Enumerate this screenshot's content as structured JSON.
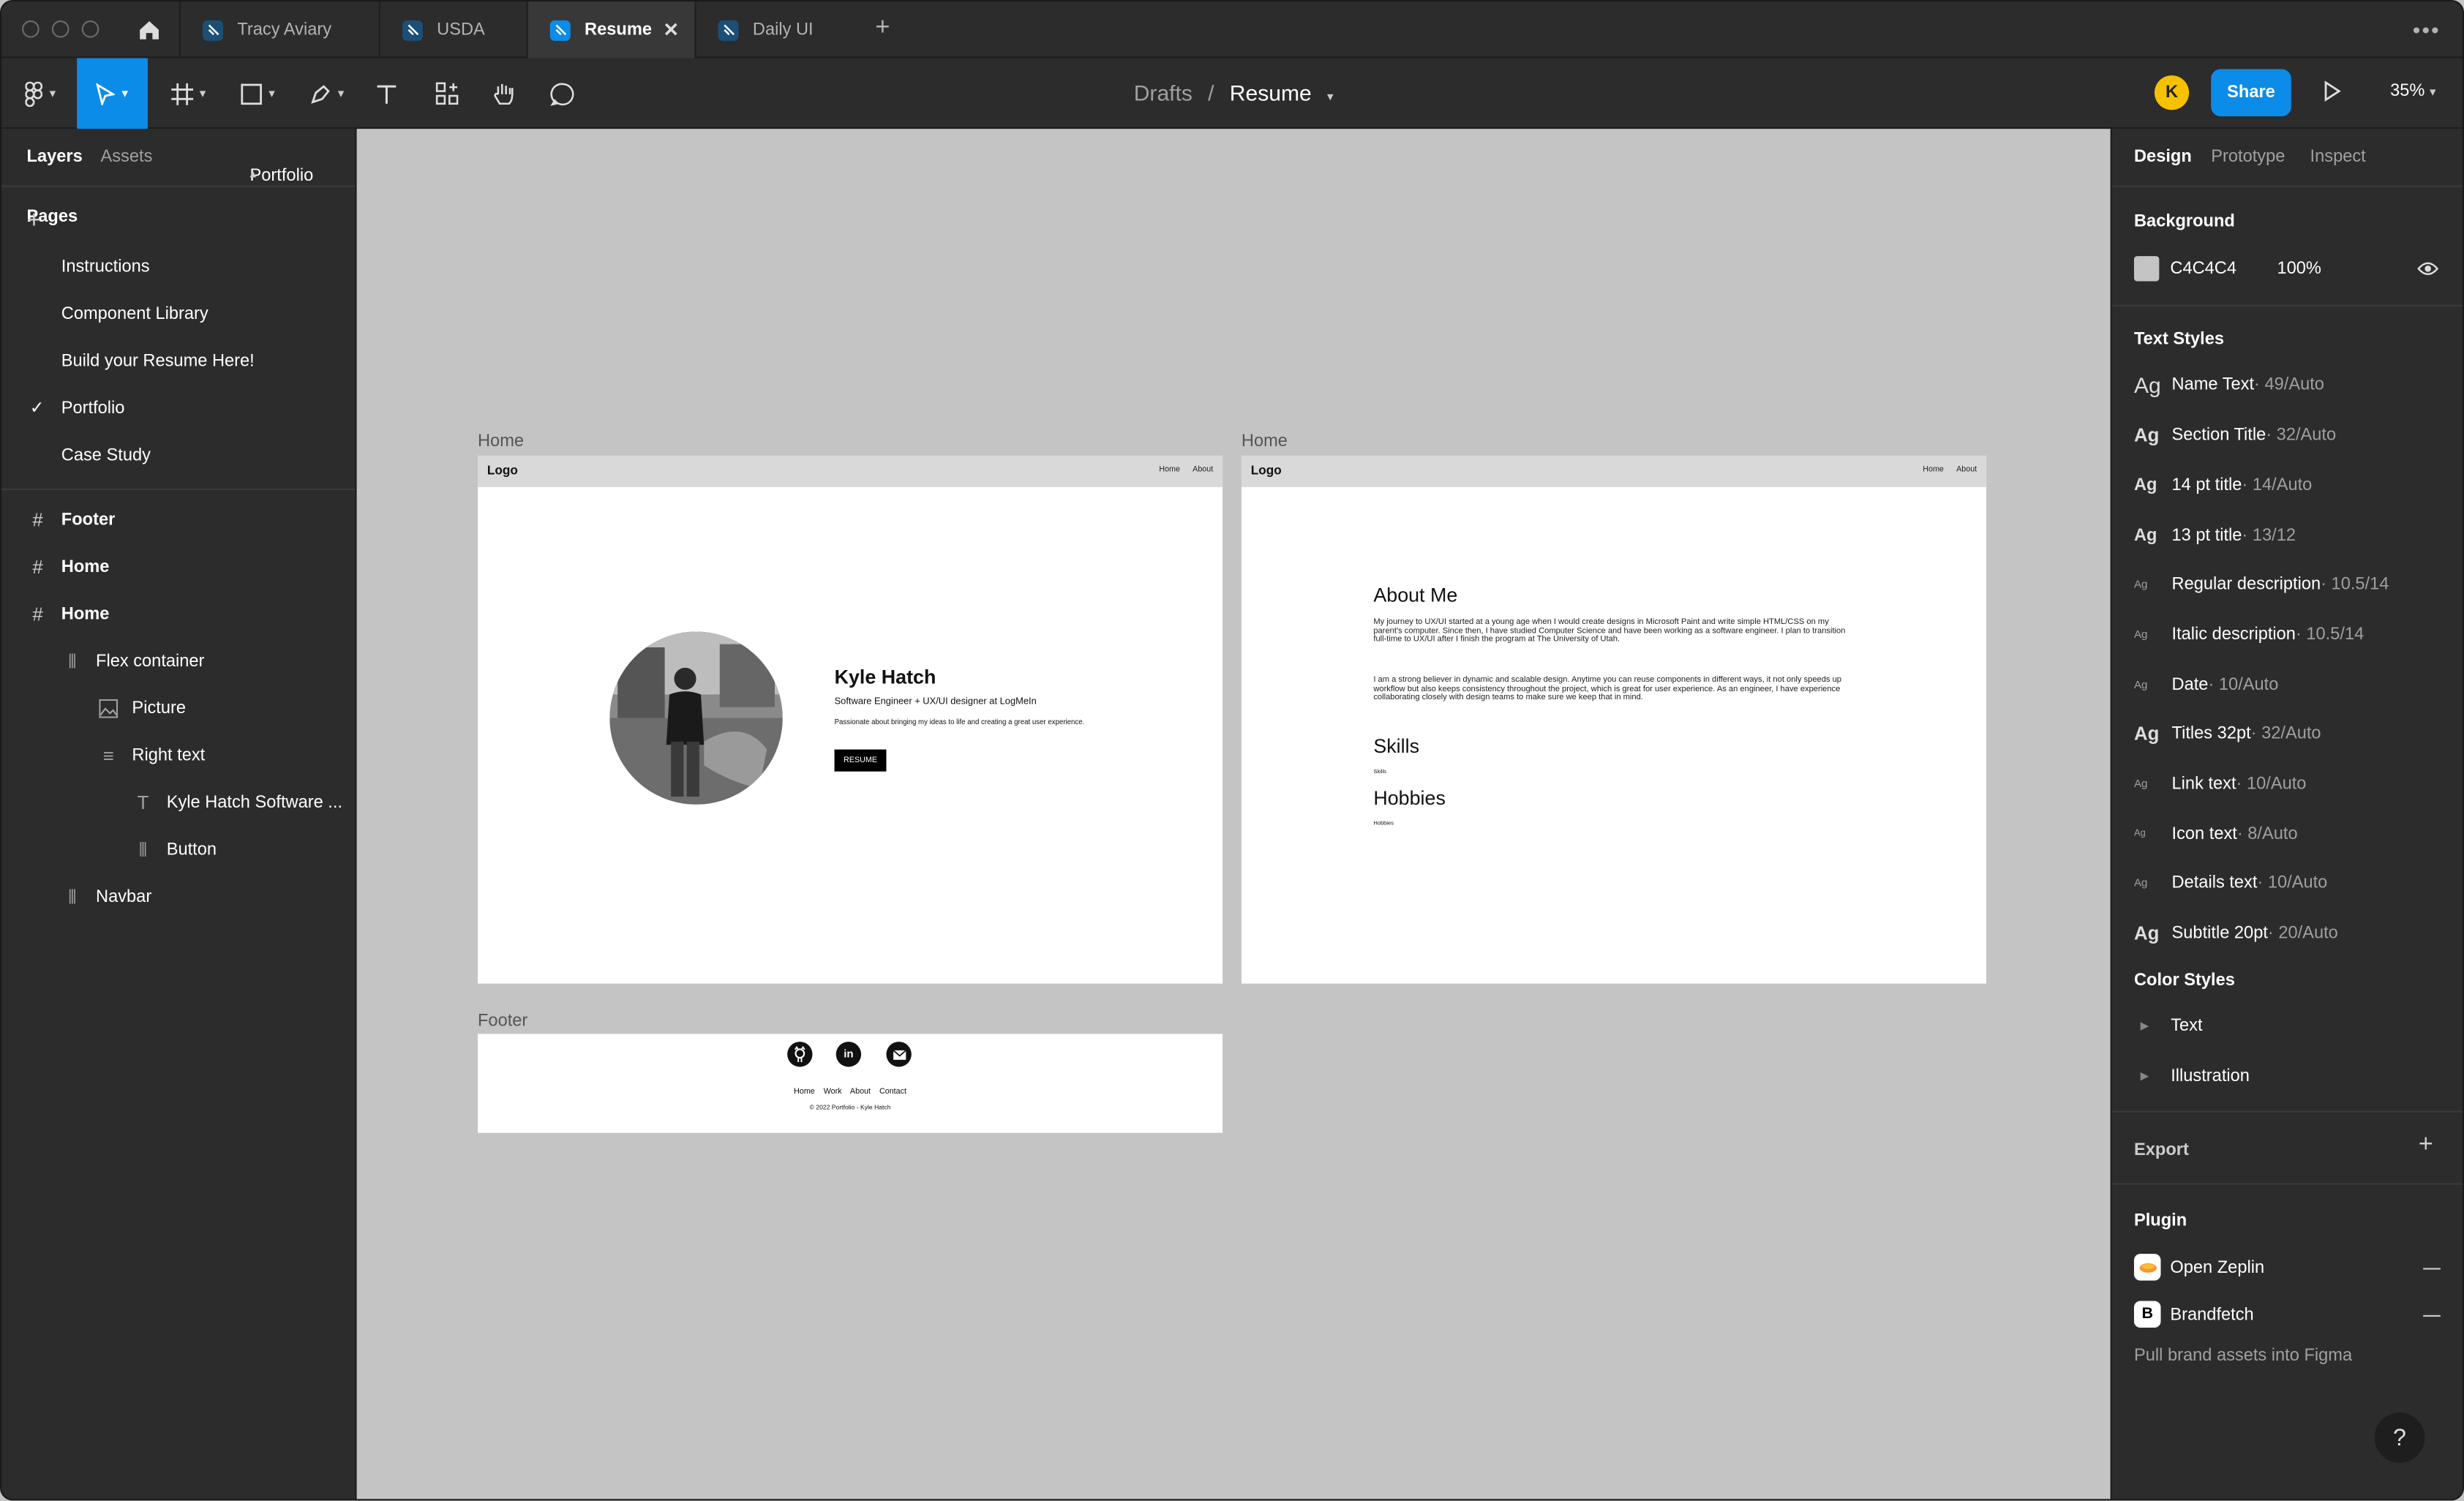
{
  "tabs": {
    "home_icon": "home-icon",
    "items": [
      {
        "label": "Tracy Aviary"
      },
      {
        "label": "USDA"
      },
      {
        "label": "Resume"
      },
      {
        "label": "Daily UI"
      }
    ],
    "active_index": 2
  },
  "toolbar": {
    "breadcrumb_parent": "Drafts",
    "breadcrumb_separator": "/",
    "file_name": "Resume",
    "avatar_initial": "K",
    "share_label": "Share",
    "zoom": "35%"
  },
  "left_panel": {
    "tab_layers": "Layers",
    "tab_assets": "Assets",
    "current_page": "Portfolio",
    "pages_header": "Pages",
    "pages": [
      {
        "label": "Instructions"
      },
      {
        "label": "Component Library"
      },
      {
        "label": "Build your Resume Here!"
      },
      {
        "label": "Portfolio"
      },
      {
        "label": "Case Study"
      }
    ],
    "layers": [
      {
        "label": "Footer"
      },
      {
        "label": "Home"
      },
      {
        "label": "Home"
      },
      {
        "label": "Flex container"
      },
      {
        "label": "Picture"
      },
      {
        "label": "Right text"
      },
      {
        "label": "Kyle Hatch Software ..."
      },
      {
        "label": "Button"
      },
      {
        "label": "Navbar"
      }
    ]
  },
  "right_panel": {
    "tab_design": "Design",
    "tab_prototype": "Prototype",
    "tab_inspect": "Inspect",
    "background_header": "Background",
    "background_hex": "C4C4C4",
    "background_opacity": "100%",
    "background_color": "#c4c4c4",
    "text_styles_header": "Text Styles",
    "text_styles": [
      {
        "name": "Name Text",
        "meta": " · 49/Auto"
      },
      {
        "name": "Section Title",
        "meta": " · 32/Auto"
      },
      {
        "name": "14 pt title",
        "meta": " · 14/Auto"
      },
      {
        "name": "13 pt title",
        "meta": " · 13/12"
      },
      {
        "name": "Regular description",
        "meta": " · 10.5/14"
      },
      {
        "name": "Italic description",
        "meta": " · 10.5/14"
      },
      {
        "name": "Date",
        "meta": " · 10/Auto"
      },
      {
        "name": "Titles 32pt",
        "meta": " · 32/Auto"
      },
      {
        "name": "Link text",
        "meta": " · 10/Auto"
      },
      {
        "name": "Icon text",
        "meta": " · 8/Auto"
      },
      {
        "name": "Details text",
        "meta": " · 10/Auto"
      },
      {
        "name": "Subtitle 20pt",
        "meta": " · 20/Auto"
      }
    ],
    "text_style_icon": "Ag",
    "color_styles_header": "Color Styles",
    "color_styles": [
      {
        "label": "Text"
      },
      {
        "label": "Illustration"
      }
    ],
    "export_header": "Export",
    "plugin_header": "Plugin",
    "plugins": [
      {
        "label": "Open Zeplin"
      },
      {
        "label": "Brandfetch"
      }
    ],
    "brandfetch_icon_letter": "B",
    "plugin_hint": "Pull brand assets into Figma",
    "help_label": "?"
  },
  "canvas": {
    "home1": {
      "label": "Home",
      "nav_logo": "Logo",
      "nav_links": [
        "Home",
        "About"
      ],
      "name": "Kyle Hatch",
      "role": "Software Engineer + UX/UI designer at LogMeIn",
      "tagline": "Passionate about bringing my ideas to life and creating a great user experience.",
      "button": "RESUME"
    },
    "home2": {
      "label": "Home",
      "nav_logo": "Logo",
      "nav_links": [
        "Home",
        "About"
      ],
      "about_title": "About Me",
      "about_p1": "My journey to UX/UI started at a young age when I would create designs in Microsoft Paint and write simple HTML/CSS on my parent's computer. Since then, I have studied Computer Science and have been working as a software engineer. I plan to transition full-time to UX/UI after I finish the program at The University of Utah.",
      "about_p2": "I am a strong believer in dynamic and scalable design. Anytime you can reuse components in different ways, it not only speeds up workflow but also keeps consistency throughout the project, which is great for user experience. As an engineer, I have experience collaborating closely with design teams to make sure we keep that in mind.",
      "skills_title": "Skills",
      "skills_text": "Skills",
      "hobbies_title": "Hobbies",
      "hobbies_text": "Hobbies"
    },
    "footer": {
      "label": "Footer",
      "icons": [
        "github-icon",
        "linkedin-icon",
        "email-icon"
      ],
      "links": [
        "Home",
        "Work",
        "About",
        "Contact"
      ],
      "copyright": "© 2022 Portfolio - Kyle Hatch"
    }
  }
}
